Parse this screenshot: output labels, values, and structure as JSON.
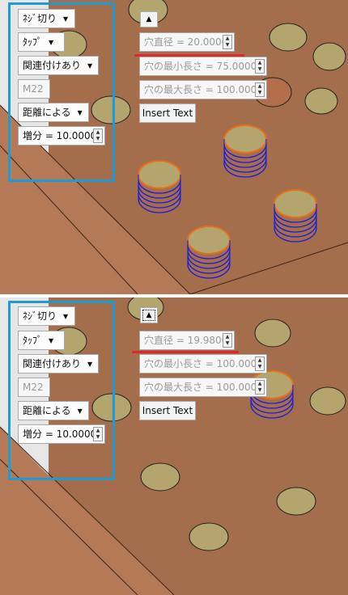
{
  "controls": {
    "thread_cut": "ﾈｼﾞ切り",
    "tap": "ﾀｯﾌﾟ",
    "related": "関連付けあり",
    "size": "M22",
    "by_distance": "距離による",
    "increment": "増分 = 10.0000",
    "insert_text": "Insert Text"
  },
  "top": {
    "hole_diameter": "穴直径 = 20.0000",
    "hole_min_length": "穴の最小長さ = 75.0000",
    "hole_max_length": "穴の最大長さ = 100.0000"
  },
  "bottom": {
    "hole_diameter": "穴直径 = 19.9800",
    "hole_min_length": "穴の最小長さ = 100.0000",
    "hole_max_length": "穴の最大長さ = 100.0000"
  },
  "colors": {
    "plate_top": "#a46e4c",
    "plate_side": "#b47a58",
    "hole": "#b4a56e",
    "thread_blue": "#1a1adc",
    "thread_orange": "#e07020",
    "highlight_box": "#1f9bd4",
    "underline": "#e0262e"
  }
}
